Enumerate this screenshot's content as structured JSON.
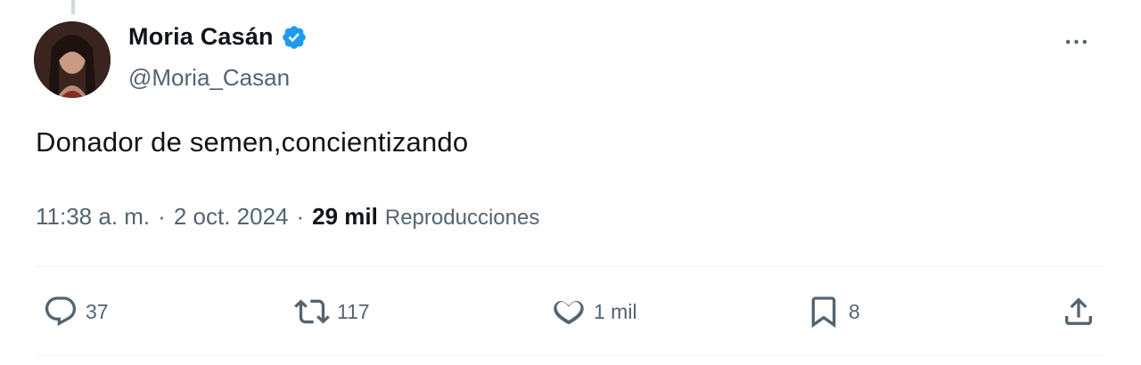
{
  "tweet": {
    "author": {
      "display_name": "Moria Casán",
      "handle": "@Moria_Casan",
      "verified": true
    },
    "text": "Donador de semen,concientizando",
    "meta": {
      "time": "11:38 a. m.",
      "separator": "·",
      "date": "2 oct. 2024",
      "views_count": "29 mil",
      "views_label": "Reproducciones"
    },
    "actions": {
      "replies": "37",
      "retweets": "117",
      "likes": "1 mil",
      "bookmarks": "8"
    }
  },
  "icons": {
    "verified": "verified-badge-icon",
    "more": "more-options-icon",
    "reply": "reply-icon",
    "retweet": "retweet-icon",
    "like": "heart-icon",
    "bookmark": "bookmark-icon",
    "share": "share-icon"
  },
  "colors": {
    "verified_blue": "#1d9bf0",
    "secondary_text": "#536471",
    "primary_text": "#0f1419",
    "divider": "#eff3f4"
  }
}
